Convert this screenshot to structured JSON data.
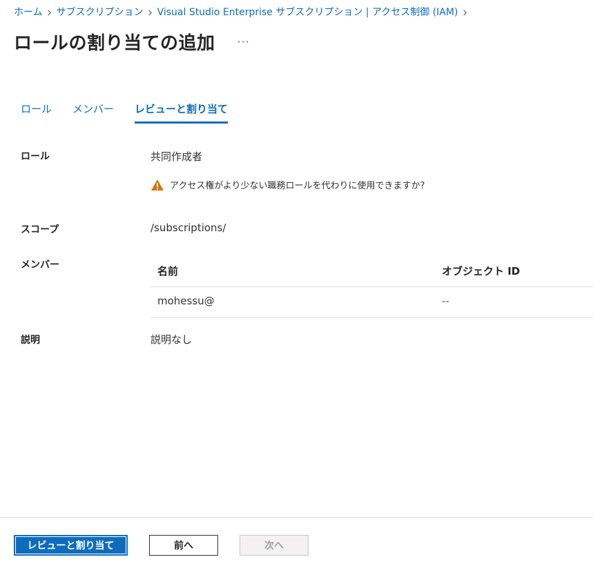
{
  "breadcrumb": [
    "ホーム",
    "サブスクリプション",
    "Visual Studio Enterprise サブスクリプション | アクセス制御 (IAM)"
  ],
  "page": {
    "title": "ロールの割り当ての追加",
    "more": "···"
  },
  "tabs": [
    {
      "label": "ロール",
      "active": false
    },
    {
      "label": "メンバー",
      "active": false
    },
    {
      "label": "レビューと割り当て",
      "active": true
    }
  ],
  "review": {
    "role_label": "ロール",
    "role_value": "共同作成者",
    "warning_text": "アクセス権がより少ない職務ロールを代わりに使用できますか?",
    "scope_label": "スコープ",
    "scope_value": "/subscriptions/",
    "members_label": "メンバー",
    "description_label": "説明",
    "description_value": "説明なし"
  },
  "members_table": {
    "columns": [
      "名前",
      "オブジェクト ID"
    ],
    "rows": [
      {
        "name": "mohessu@",
        "object_id": "--"
      }
    ]
  },
  "footer": {
    "review_assign": "レビューと割り当て",
    "previous": "前へ",
    "next": "次へ"
  },
  "colors": {
    "accent": "#0f6cbd",
    "warning": "#d47500"
  },
  "icons": {
    "breadcrumb_separator": "chevron-right-icon",
    "warning": "warning-icon"
  }
}
